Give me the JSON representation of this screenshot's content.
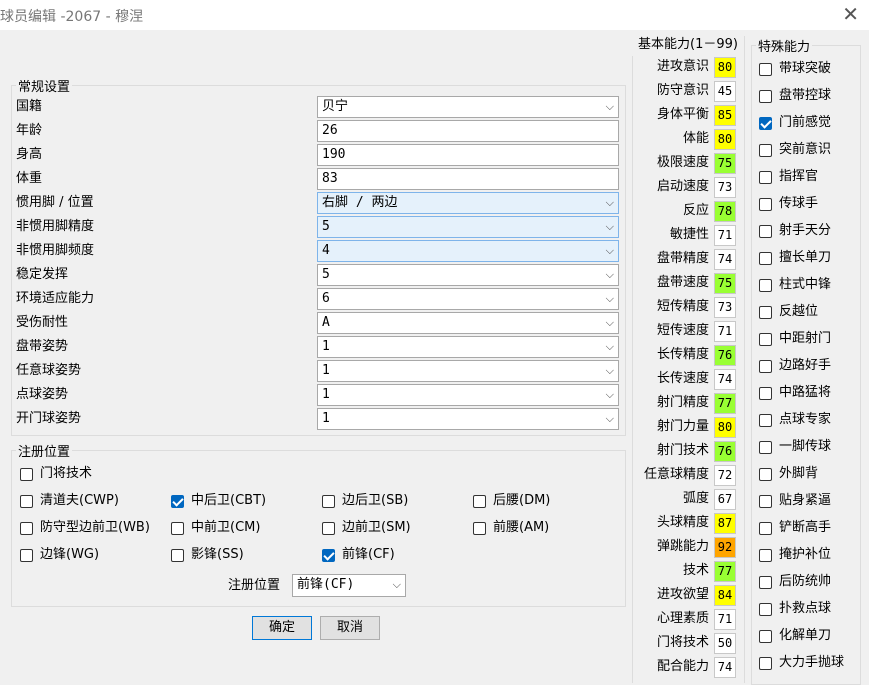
{
  "window": {
    "title": "球员编辑 -2067 - 穆涅"
  },
  "general": {
    "legend": "常规设置",
    "rows": [
      {
        "label": "国籍",
        "value": "贝宁",
        "dropdown": true,
        "highlight": false
      },
      {
        "label": "年龄",
        "value": "26",
        "dropdown": false,
        "highlight": false
      },
      {
        "label": "身高",
        "value": "190",
        "dropdown": false,
        "highlight": false
      },
      {
        "label": "体重",
        "value": "83",
        "dropdown": false,
        "highlight": false
      },
      {
        "label": "惯用脚 / 位置",
        "value": "右脚 / 两边",
        "dropdown": true,
        "highlight": true
      },
      {
        "label": "非惯用脚精度",
        "value": "5",
        "dropdown": true,
        "highlight": true
      },
      {
        "label": "非惯用脚频度",
        "value": "4",
        "dropdown": true,
        "highlight": true
      },
      {
        "label": "稳定发挥",
        "value": "5",
        "dropdown": true,
        "highlight": false
      },
      {
        "label": "环境适应能力",
        "value": "6",
        "dropdown": true,
        "highlight": false
      },
      {
        "label": "受伤耐性",
        "value": "A",
        "dropdown": true,
        "highlight": false
      },
      {
        "label": "盘带姿势",
        "value": "1",
        "dropdown": true,
        "highlight": false
      },
      {
        "label": "任意球姿势",
        "value": "1",
        "dropdown": true,
        "highlight": false
      },
      {
        "label": "点球姿势",
        "value": "1",
        "dropdown": true,
        "highlight": false
      },
      {
        "label": "开门球姿势",
        "value": "1",
        "dropdown": true,
        "highlight": false
      }
    ]
  },
  "positions": {
    "legend": "注册位置",
    "items": [
      {
        "label": "门将技术",
        "checked": false
      },
      {
        "label": "清道夫(CWP)",
        "checked": false
      },
      {
        "label": "中后卫(CBT)",
        "checked": true
      },
      {
        "label": "边后卫(SB)",
        "checked": false
      },
      {
        "label": "后腰(DM)",
        "checked": false
      },
      {
        "label": "防守型边前卫(WB)",
        "checked": false
      },
      {
        "label": "中前卫(CM)",
        "checked": false
      },
      {
        "label": "边前卫(SM)",
        "checked": false
      },
      {
        "label": "前腰(AM)",
        "checked": false
      },
      {
        "label": "边锋(WG)",
        "checked": false
      },
      {
        "label": "影锋(SS)",
        "checked": false
      },
      {
        "label": "前锋(CF)",
        "checked": true
      }
    ],
    "registered_label": "注册位置",
    "registered_value": "前锋(CF)"
  },
  "buttons": {
    "ok": "确定",
    "cancel": "取消"
  },
  "abilities": {
    "header": "基本能力(1－99)",
    "items": [
      {
        "label": "进攻意识",
        "value": "80",
        "color": "#ffff00"
      },
      {
        "label": "防守意识",
        "value": "45",
        "color": "#ffffff"
      },
      {
        "label": "身体平衡",
        "value": "85",
        "color": "#ffff00"
      },
      {
        "label": "体能",
        "value": "80",
        "color": "#ffff00"
      },
      {
        "label": "极限速度",
        "value": "75",
        "color": "#99ff33"
      },
      {
        "label": "启动速度",
        "value": "73",
        "color": "#ffffff"
      },
      {
        "label": "反应",
        "value": "78",
        "color": "#99ff33"
      },
      {
        "label": "敏捷性",
        "value": "71",
        "color": "#ffffff"
      },
      {
        "label": "盘带精度",
        "value": "74",
        "color": "#ffffff"
      },
      {
        "label": "盘带速度",
        "value": "75",
        "color": "#99ff33"
      },
      {
        "label": "短传精度",
        "value": "73",
        "color": "#ffffff"
      },
      {
        "label": "短传速度",
        "value": "71",
        "color": "#ffffff"
      },
      {
        "label": "长传精度",
        "value": "76",
        "color": "#99ff33"
      },
      {
        "label": "长传速度",
        "value": "74",
        "color": "#ffffff"
      },
      {
        "label": "射门精度",
        "value": "77",
        "color": "#99ff33"
      },
      {
        "label": "射门力量",
        "value": "80",
        "color": "#ffff00"
      },
      {
        "label": "射门技术",
        "value": "76",
        "color": "#99ff33"
      },
      {
        "label": "任意球精度",
        "value": "72",
        "color": "#ffffff"
      },
      {
        "label": "弧度",
        "value": "67",
        "color": "#ffffff"
      },
      {
        "label": "头球精度",
        "value": "87",
        "color": "#ffff00"
      },
      {
        "label": "弹跳能力",
        "value": "92",
        "color": "#ffa500"
      },
      {
        "label": "技术",
        "value": "77",
        "color": "#99ff33"
      },
      {
        "label": "进攻欲望",
        "value": "84",
        "color": "#ffff00"
      },
      {
        "label": "心理素质",
        "value": "71",
        "color": "#ffffff"
      },
      {
        "label": "门将技术",
        "value": "50",
        "color": "#ffffff"
      },
      {
        "label": "配合能力",
        "value": "74",
        "color": "#ffffff"
      }
    ]
  },
  "special": {
    "header": "特殊能力",
    "items": [
      {
        "label": "带球突破",
        "checked": false
      },
      {
        "label": "盘带控球",
        "checked": false
      },
      {
        "label": "门前感觉",
        "checked": true
      },
      {
        "label": "突前意识",
        "checked": false
      },
      {
        "label": "指挥官",
        "checked": false
      },
      {
        "label": "传球手",
        "checked": false
      },
      {
        "label": "射手天分",
        "checked": false
      },
      {
        "label": "擅长单刀",
        "checked": false
      },
      {
        "label": "柱式中锋",
        "checked": false
      },
      {
        "label": "反越位",
        "checked": false
      },
      {
        "label": "中距射门",
        "checked": false
      },
      {
        "label": "边路好手",
        "checked": false
      },
      {
        "label": "中路猛将",
        "checked": false
      },
      {
        "label": "点球专家",
        "checked": false
      },
      {
        "label": "一脚传球",
        "checked": false
      },
      {
        "label": "外脚背",
        "checked": false
      },
      {
        "label": "贴身紧逼",
        "checked": false
      },
      {
        "label": "铲断高手",
        "checked": false
      },
      {
        "label": "掩护补位",
        "checked": false
      },
      {
        "label": "后防统帅",
        "checked": false
      },
      {
        "label": "扑救点球",
        "checked": false
      },
      {
        "label": "化解单刀",
        "checked": false
      },
      {
        "label": "大力手抛球",
        "checked": false
      }
    ]
  }
}
